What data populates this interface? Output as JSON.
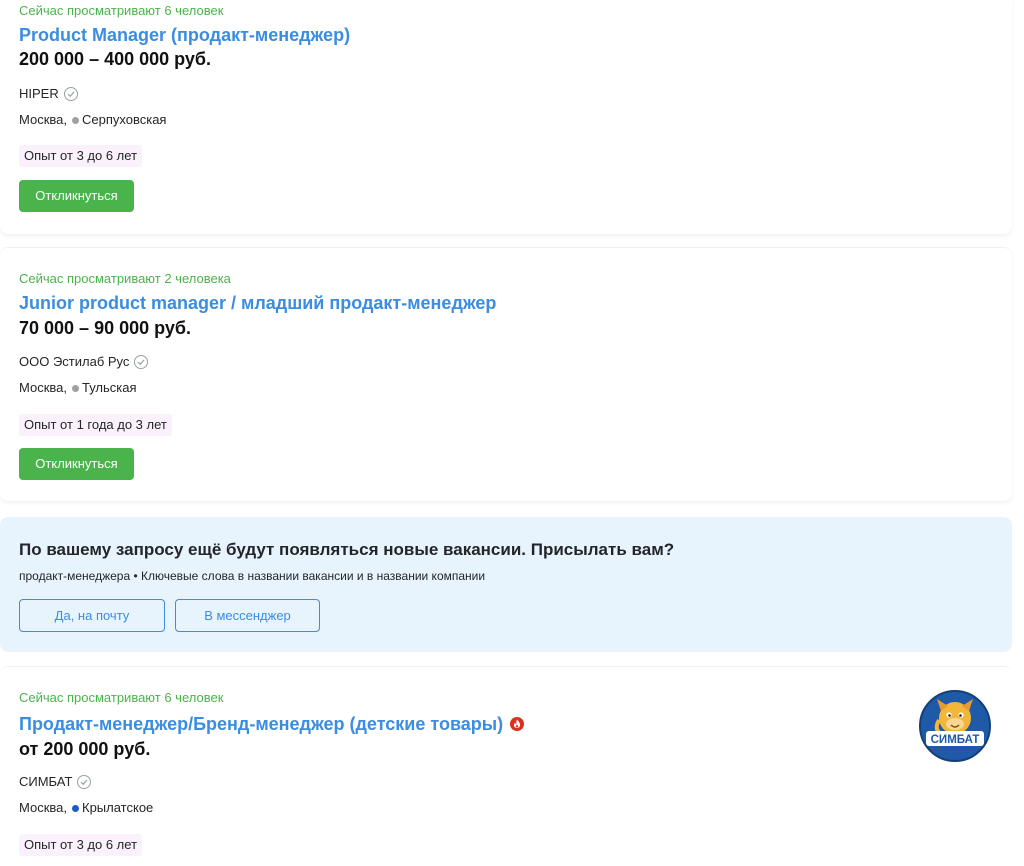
{
  "colors": {
    "accent_green": "#4bb34b",
    "link_blue": "#3a8de0",
    "metro_gray": "#a0a0a0",
    "metro_blue": "#1a5ec2",
    "experience_badge_bg": "#faf1fd",
    "subscribe_bg": "#e8f4fd",
    "hot_red": "#d9321f"
  },
  "vacancies": [
    {
      "viewing": "Сейчас просматривают 6 человек",
      "title": "Product Manager (продакт-менеджер)",
      "salary": "200 000 – 400 000 руб.",
      "company": "HIPER",
      "city": "Москва,",
      "metro": "Серпуховская",
      "metro_color": "#a0a0a0",
      "experience": "Опыт от 3 до 6 лет",
      "apply_label": "Откликнуться"
    },
    {
      "viewing": "Сейчас просматривают 2 человека",
      "title": "Junior product manager / младший продакт-менеджер",
      "salary": "70 000 – 90 000 руб.",
      "company": "ООО Эстилаб Рус",
      "city": "Москва,",
      "metro": "Тульская",
      "metro_color": "#a0a0a0",
      "experience": "Опыт от 1 года до 3 лет",
      "apply_label": "Откликнуться"
    },
    {
      "viewing": "Сейчас просматривают 6 человек",
      "title": "Продакт-менеджер/Бренд-менеджер (детские товары)",
      "salary": "от 200 000 руб.",
      "company": "СИМБАТ",
      "city": "Москва,",
      "metro": "Крылатское",
      "metro_color": "#1a5ec2",
      "experience": "Опыт от 3 до 6 лет",
      "logo_text": "СИМБАТ",
      "hot_icon": "fire-icon"
    }
  ],
  "subscribe": {
    "title": "По вашему запросу ещё будут появляться новые вакансии. Присылать вам?",
    "description": "продакт-менеджера • Ключевые слова в названии вакансии и в названии компании",
    "email_button": "Да, на почту",
    "messenger_button": "В мессенджер"
  }
}
